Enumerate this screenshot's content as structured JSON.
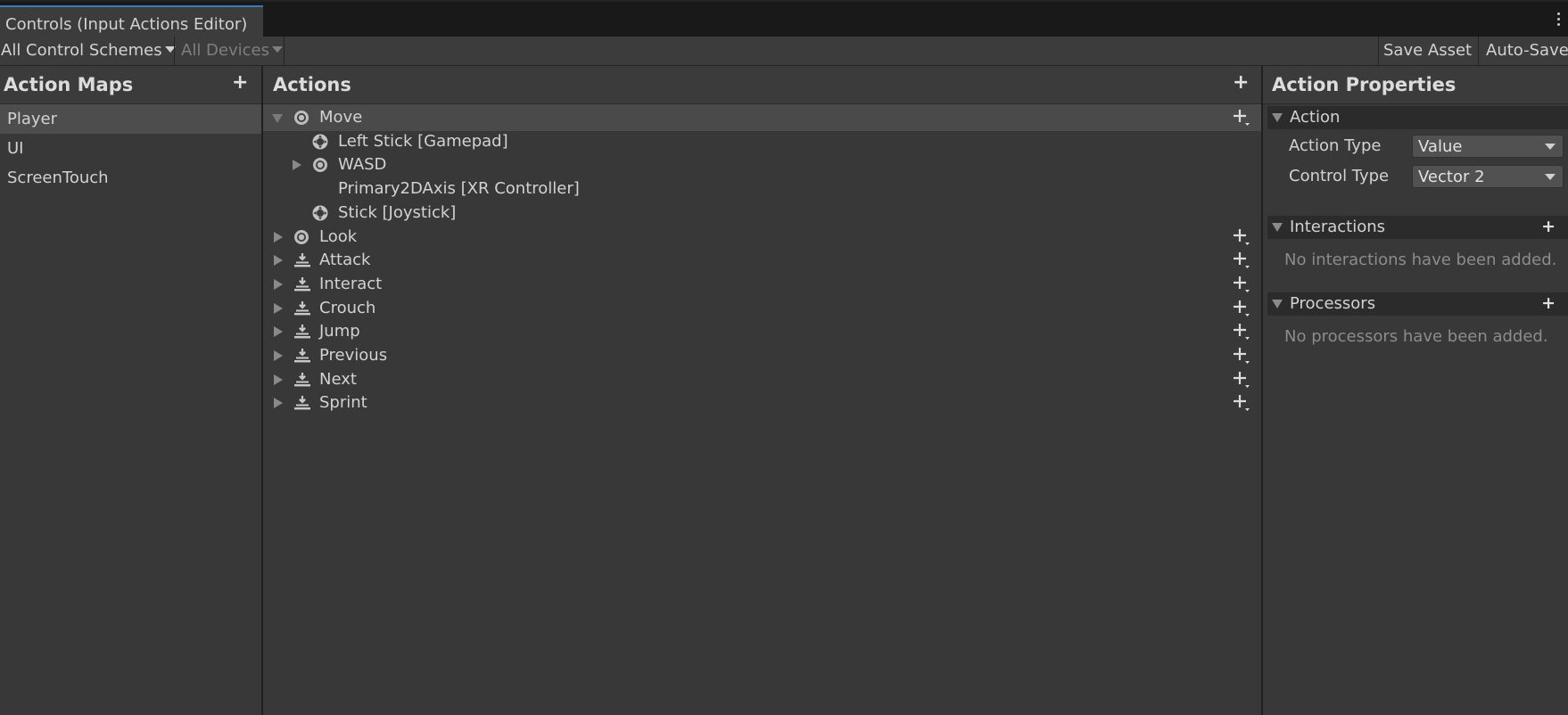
{
  "window": {
    "tab_title": "Controls (Input Actions Editor)"
  },
  "toolbar": {
    "control_schemes": "All Control Schemes",
    "devices": "All Devices",
    "save_asset": "Save Asset",
    "auto_save": "Auto-Save"
  },
  "action_maps": {
    "title": "Action Maps",
    "add": "+",
    "items": [
      {
        "label": "Player",
        "selected": true
      },
      {
        "label": "UI",
        "selected": false
      },
      {
        "label": "ScreenTouch",
        "selected": false
      }
    ]
  },
  "actions": {
    "title": "Actions",
    "add": "+",
    "rows": [
      {
        "label": "Move",
        "level": 0,
        "expanded": true,
        "icon": "value-action-icon",
        "add": true,
        "selected": true
      },
      {
        "label": "Left Stick [Gamepad]",
        "level": 1,
        "icon": "gamepad-stick-icon"
      },
      {
        "label": "WASD",
        "level": 1,
        "collapsed": true,
        "icon": "composite-icon"
      },
      {
        "label": "Primary2DAxis [XR Controller]",
        "level": 1,
        "icon": "none"
      },
      {
        "label": "Stick [Joystick]",
        "level": 1,
        "icon": "gamepad-stick-icon"
      },
      {
        "label": "Look",
        "level": 0,
        "collapsed": true,
        "icon": "value-action-icon",
        "add": true
      },
      {
        "label": "Attack",
        "level": 0,
        "collapsed": true,
        "icon": "button-action-icon",
        "add": true
      },
      {
        "label": "Interact",
        "level": 0,
        "collapsed": true,
        "icon": "button-action-icon",
        "add": true
      },
      {
        "label": "Crouch",
        "level": 0,
        "collapsed": true,
        "icon": "button-action-icon",
        "add": true
      },
      {
        "label": "Jump",
        "level": 0,
        "collapsed": true,
        "icon": "button-action-icon",
        "add": true
      },
      {
        "label": "Previous",
        "level": 0,
        "collapsed": true,
        "icon": "button-action-icon",
        "add": true
      },
      {
        "label": "Next",
        "level": 0,
        "collapsed": true,
        "icon": "button-action-icon",
        "add": true
      },
      {
        "label": "Sprint",
        "level": 0,
        "collapsed": true,
        "icon": "button-action-icon",
        "add": true
      }
    ]
  },
  "properties": {
    "title": "Action Properties",
    "action_section": {
      "title": "Action",
      "action_type_label": "Action Type",
      "action_type_value": "Value",
      "control_type_label": "Control Type",
      "control_type_value": "Vector 2"
    },
    "interactions_section": {
      "title": "Interactions",
      "add": "+",
      "empty": "No interactions have been added."
    },
    "processors_section": {
      "title": "Processors",
      "add": "+",
      "empty": "No processors have been added."
    }
  }
}
